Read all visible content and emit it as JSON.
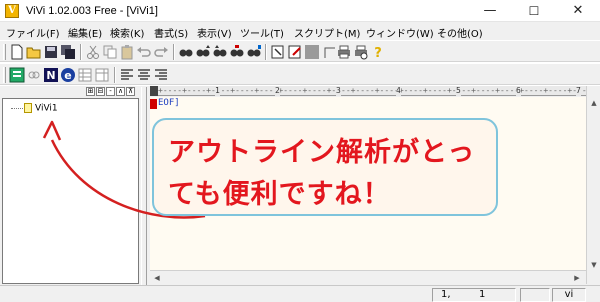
{
  "window": {
    "title": "ViVi 1.02.003 Free - [ViVi1]",
    "icon_letter": "V",
    "minimize_glyph": "—",
    "maximize_glyph": "☐",
    "close_glyph": "✕"
  },
  "menu": [
    {
      "label": "ファイル(F)"
    },
    {
      "label": "編集(E)"
    },
    {
      "label": "検索(K)"
    },
    {
      "label": "書式(S)"
    },
    {
      "label": "表示(V)"
    },
    {
      "label": "ツール(T)"
    },
    {
      "label": "スクリプト(M)"
    },
    {
      "label": "ウィンドウ(W)"
    },
    {
      "label": "その他(O)"
    }
  ],
  "toolbar1": [
    "new-file-icon",
    "open-folder-icon",
    "save-icon",
    "save-all-icon",
    "cut-icon",
    "copy-icon",
    "paste-icon",
    "undo-icon",
    "redo-icon",
    "find-icon",
    "find-next-icon",
    "find-prev-icon",
    "replace-icon",
    "grep-icon",
    "jump-icon",
    "edit-icon",
    "gray-box-icon",
    "corner-icon",
    "print-icon",
    "print-preview-icon",
    "help-icon"
  ],
  "toolbar2": [
    "outline-icon",
    "link-icon",
    "n-icon",
    "e-icon",
    "table-icon",
    "table-alt-icon",
    "align-left-icon",
    "align-center-icon",
    "align-right-icon"
  ],
  "outline": {
    "header_buttons": [
      "⊞",
      "⊟",
      "-",
      "∧",
      "⊼"
    ],
    "tree_items": [
      {
        "label": "ViVi1"
      }
    ]
  },
  "editor": {
    "eof_text": "EOF]",
    "ruler_numbers": [
      "1",
      "2",
      "3",
      "4",
      "5",
      "6",
      "7"
    ]
  },
  "statusbar": {
    "line": "1,",
    "column": "1",
    "mode": "vi"
  },
  "annotation": {
    "line1": "アウトライン解析がとっ",
    "line2": "ても便利ですね！",
    "text_color": "#e3171e",
    "border_color": "#7fc4dc",
    "arrow_color": "#d42020"
  }
}
